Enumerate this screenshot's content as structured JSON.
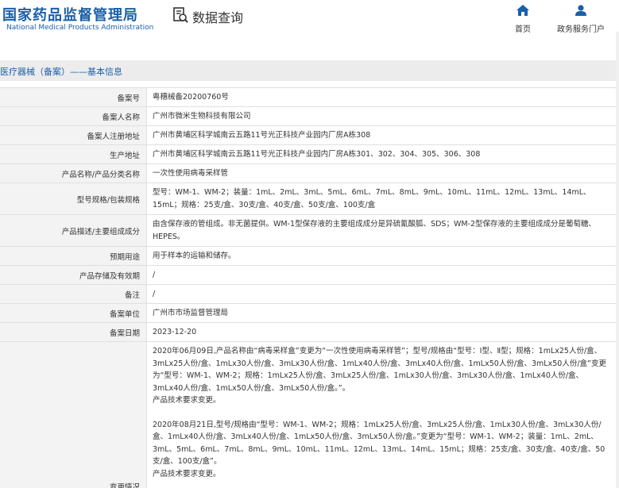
{
  "header": {
    "logo_cn": "国家药品监督管理局",
    "logo_en": "National Medical Products Administration",
    "query_label": "数据查询",
    "nav": [
      {
        "label": "首页",
        "icon": "home-icon"
      },
      {
        "label": "政务服务门户",
        "icon": "user-icon"
      }
    ]
  },
  "section": {
    "title": "医疗器械（备案）——基本信息"
  },
  "record": {
    "rows": [
      {
        "label": "备案号",
        "value": "粤穗械备20200760号"
      },
      {
        "label": "备案人名称",
        "value": "广州市微米生物科技有限公司"
      },
      {
        "label": "备案人注册地址",
        "value": "广州市黄埔区科学城南云五路11号光正科技产业园内厂房A栋308"
      },
      {
        "label": "生产地址",
        "value": "广州市黄埔区科学城南云五路11号光正科技产业园内厂房A栋301、302、304、305、306、308"
      },
      {
        "label": "产品名称/产品分类名称",
        "value": "一次性使用病毒采样管"
      },
      {
        "label": "型号规格/包装规格",
        "value": "型号：WM-1、WM-2；装量：1mL、2mL、3mL、5mL、6mL、7mL、8mL、9mL、10mL、11mL、12mL、13mL、14mL、15mL；规格：25支/盒、30支/盒、40支/盒、50支/盒、100支/盒"
      },
      {
        "label": "产品描述/主要组成成分",
        "value": "由含保存液的管组成。非无菌提供。WM-1型保存液的主要组成成分是异硫氰酸胍、SDS；WM-2型保存液的主要组成成分是葡萄糖、HEPES。"
      },
      {
        "label": "预期用途",
        "value": "用于样本的运输和储存。"
      },
      {
        "label": "产品存储及有效期",
        "value": "/"
      },
      {
        "label": "备注",
        "value": "/"
      },
      {
        "label": "备案单位",
        "value": "广州市市场监督管理局"
      },
      {
        "label": "备案日期",
        "value": "2023-12-20"
      }
    ],
    "change": {
      "label": "变更情况",
      "paragraphs": [
        "2020年06月09日,产品名称由“病毒采样盒”变更为“一次性使用病毒采样管”；型号/规格由“型号：Ⅰ型、Ⅱ型；规格：1mLx25人份/盒、3mLx25人份/盒、1mLx30人份/盒、3mLx30人份/盒、1mLx40人份/盒、3mLx40人份/盒、1mLx50人份/盒、3mLx50人份/盒”变更为“型号：WM-1、WM-2；规格：1mLx25人份/盒、3mLx25人份/盒、1mLx30人份/盒、3mLx30人份/盒、1mLx40人份/盒、3mLx40人份/盒、1mLx50人份/盒、3mLx50人份/盒。”。",
        "产品技术要求变更。",
        "",
        "2020年08月21日,型号/规格由“型号：WM-1、WM-2；规格：1mLx25人份/盒、3mLx25人份/盒、1mLx30人份/盒、3mLx30人份/盒、1mLx40人份/盒、3mLx40人份/盒、1mLx50人份/盒、3mLx50人份/盒。”变更为“型号：WM-1、WM-2；装量：1mL、2mL、3mL、5mL、6mL、7mL、8mL、9mL、10mL、11mL、12mL、13mL、14mL、15mL；规格：25支/盒、30支/盒、40支/盒、50支/盒、100支/盒”。",
        "产品技术要求变更。"
      ]
    }
  },
  "colors": {
    "brand": "#1b5fa8",
    "label_bg": "#f3f3f3",
    "section_bg": "#ececec"
  }
}
